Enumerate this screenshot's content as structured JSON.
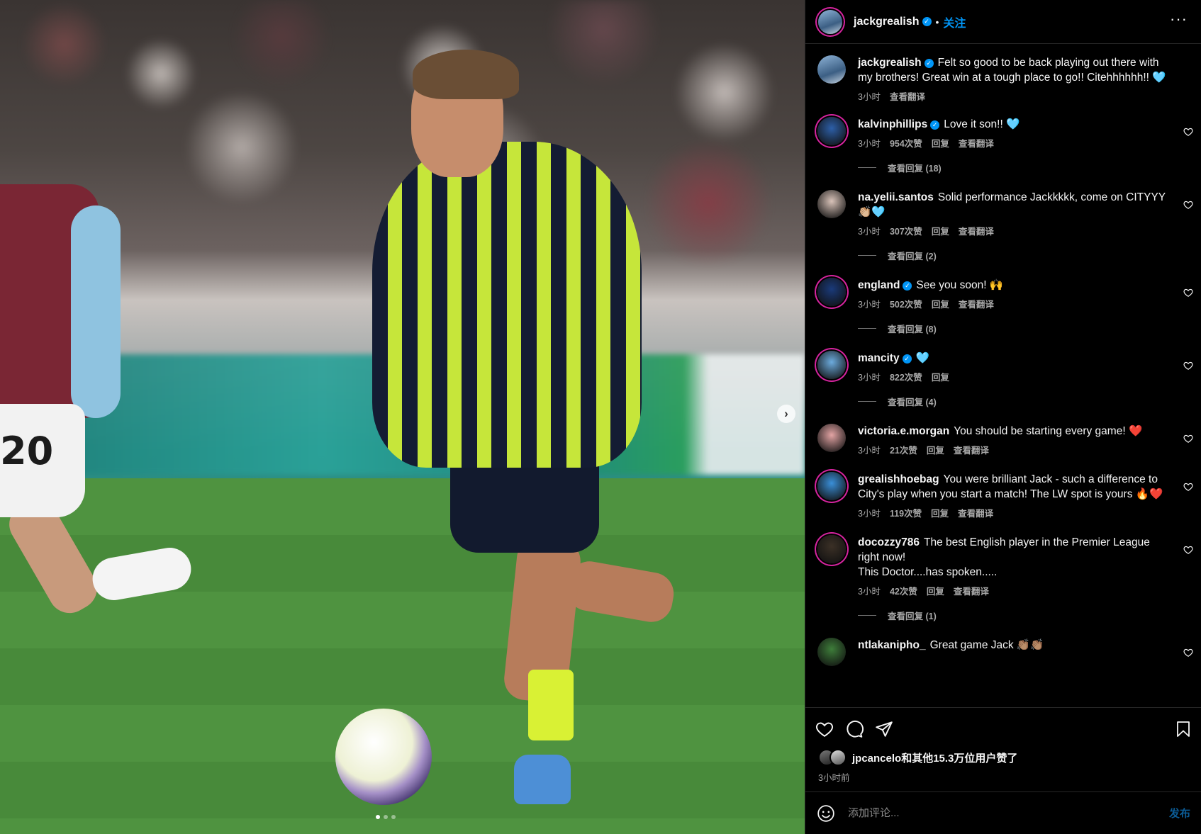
{
  "header": {
    "username": "jackgrealish",
    "separator": "•",
    "follow_label": "关注",
    "more_label": "···"
  },
  "photo": {
    "player_number": "20",
    "next_arrow": "›",
    "carousel_index": 1,
    "carousel_count": 3
  },
  "caption": {
    "username": "jackgrealish",
    "text": "Felt so good to be back playing out there with my brothers! Great win at a tough place to go!! Citehhhhhh!! 🩵",
    "time": "3小时",
    "translate": "查看翻译"
  },
  "comments": [
    {
      "username": "kalvinphillips",
      "verified": true,
      "text": "Love it son!! 🩵",
      "time": "3小时",
      "likes": "954次赞",
      "reply": "回复",
      "translate": "查看翻译",
      "replies": "查看回复 (18)"
    },
    {
      "username": "na.yelii.santos",
      "verified": false,
      "text": "Solid performance Jackkkkk, come on CITYYY 👏🏼🩵",
      "time": "3小时",
      "likes": "307次赞",
      "reply": "回复",
      "translate": "查看翻译",
      "replies": "查看回复 (2)"
    },
    {
      "username": "england",
      "verified": true,
      "text": "See you soon! 🙌",
      "time": "3小时",
      "likes": "502次赞",
      "reply": "回复",
      "translate": "查看翻译",
      "replies": "查看回复 (8)"
    },
    {
      "username": "mancity",
      "verified": true,
      "text": "🩵",
      "time": "3小时",
      "likes": "822次赞",
      "reply": "回复",
      "translate": "",
      "replies": "查看回复 (4)"
    },
    {
      "username": "victoria.e.morgan",
      "verified": false,
      "text": "You should be starting every game! ❤️",
      "time": "3小时",
      "likes": "21次赞",
      "reply": "回复",
      "translate": "查看翻译",
      "replies": ""
    },
    {
      "username": "grealishhoebag",
      "verified": false,
      "text": "You were brilliant Jack - such a difference to City's play when you start a match! The LW spot is yours 🔥❤️",
      "time": "3小时",
      "likes": "119次赞",
      "reply": "回复",
      "translate": "查看翻译",
      "replies": ""
    },
    {
      "username": "docozzy786",
      "verified": false,
      "text": "The best English player in the Premier League right now!\nThis Doctor....has spoken.....",
      "time": "3小时",
      "likes": "42次赞",
      "reply": "回复",
      "translate": "查看翻译",
      "replies": "查看回复 (1)"
    },
    {
      "username": "ntlakanipho_",
      "verified": false,
      "text": "Great game Jack 👏🏽👏🏽",
      "time": "",
      "likes": "",
      "reply": "",
      "translate": "",
      "replies": ""
    }
  ],
  "actions": {
    "like_icon": "heart-icon",
    "comment_icon": "comment-icon",
    "share_icon": "paper-plane-icon",
    "save_icon": "bookmark-icon",
    "likes_text": "jpcancelo和其他15.3万位用户赞了",
    "time_ago": "3小时前"
  },
  "add_comment": {
    "placeholder": "添加评论...",
    "post_label": "发布",
    "emoji_icon": "emoji-icon"
  },
  "colors": {
    "accent": "#0095f6",
    "muted": "#a8a8a8",
    "panel_bg": "#000000"
  }
}
